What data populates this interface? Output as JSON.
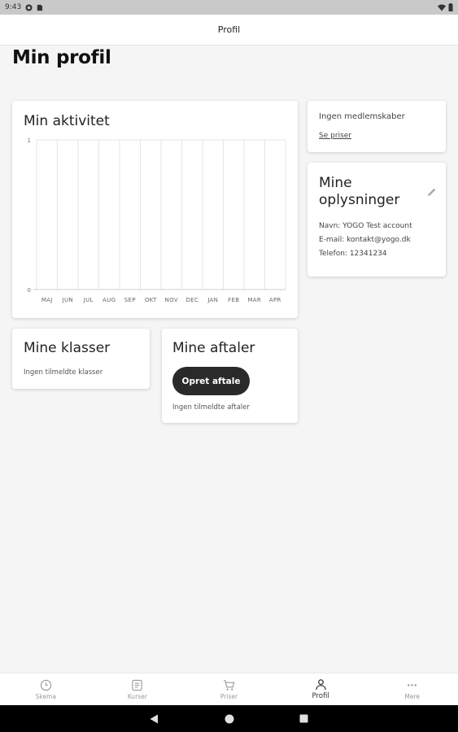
{
  "status_bar": {
    "time": "9:43"
  },
  "header": {
    "title": "Profil"
  },
  "page": {
    "title": "Min profil"
  },
  "activity": {
    "title": "Min aktivitet",
    "chart_data": {
      "type": "line",
      "categories": [
        "MAJ",
        "JUN",
        "JUL",
        "AUG",
        "SEP",
        "OKT",
        "NOV",
        "DEC",
        "JAN",
        "FEB",
        "MAR",
        "APR"
      ],
      "values": [
        0,
        0,
        0,
        0,
        0,
        0,
        0,
        0,
        0,
        0,
        0,
        0
      ],
      "y_ticks": [
        "0",
        "1"
      ],
      "ylim": [
        0,
        1
      ],
      "grid": true
    }
  },
  "membership": {
    "none_text": "Ingen medlemskaber",
    "link": "Se priser"
  },
  "info": {
    "title": "Mine oplysninger",
    "name_line": "Navn: YOGO Test account",
    "email_line": "E-mail: kontakt@yogo.dk",
    "phone_line": "Telefon: 12341234"
  },
  "classes": {
    "title": "Mine klasser",
    "empty_text": "Ingen tilmeldte klasser"
  },
  "appointments": {
    "title": "Mine aftaler",
    "button": "Opret aftale",
    "empty_text": "Ingen tilmeldte aftaler"
  },
  "bottom_nav": {
    "items": [
      {
        "label": "Skema",
        "icon": "clock-icon"
      },
      {
        "label": "Kurser",
        "icon": "list-icon"
      },
      {
        "label": "Priser",
        "icon": "cart-icon"
      },
      {
        "label": "Profil",
        "icon": "person-icon"
      },
      {
        "label": "Mere",
        "icon": "more-icon"
      }
    ],
    "active": "Profil"
  },
  "colors": {
    "button_bg": "#2a2a2a",
    "background": "#f5f5f5",
    "card": "#ffffff"
  }
}
